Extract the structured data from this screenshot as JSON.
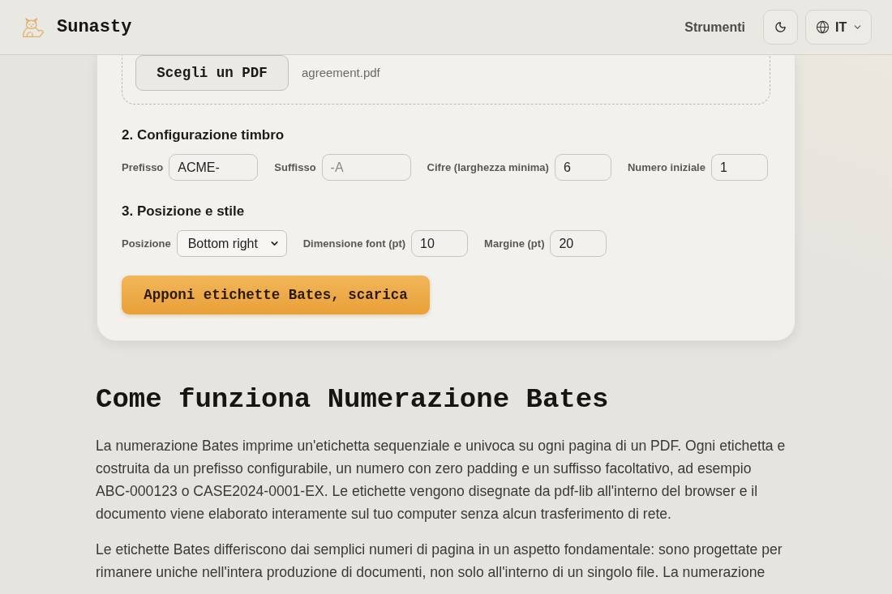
{
  "header": {
    "brand": "Sunasty",
    "nav_link": "Strumenti",
    "language": "IT"
  },
  "upload": {
    "button": "Scegli un PDF",
    "file_name": "agreement.pdf"
  },
  "sections": [
    {
      "title": "2. Configurazione timbro",
      "fields": [
        {
          "label": "Prefisso",
          "kind": "text",
          "value": "ACME-"
        },
        {
          "label": "Suffisso",
          "kind": "text",
          "placeholder": "-A"
        },
        {
          "label": "Cifre (larghezza minima)",
          "kind": "number",
          "value": "6"
        },
        {
          "label": "Numero iniziale",
          "kind": "number",
          "value": "1"
        }
      ]
    },
    {
      "title": "3. Posizione e stile",
      "fields": [
        {
          "label": "Posizione",
          "kind": "select",
          "value": "Bottom right"
        },
        {
          "label": "Dimensione font (pt)",
          "kind": "number",
          "value": "10"
        },
        {
          "label": "Margine (pt)",
          "kind": "number",
          "value": "20"
        }
      ]
    }
  ],
  "submit_button": "Apponi etichette Bates, scarica",
  "article": {
    "heading": "Come funziona Numerazione Bates",
    "paragraphs": [
      "La numerazione Bates imprime un'etichetta sequenziale e univoca su ogni pagina di un PDF. Ogni etichetta e costruita da un prefisso configurabile, un numero con zero padding e un suffisso facoltativo, ad esempio ABC-000123 o CASE2024-0001-EX. Le etichette vengono disegnate da pdf-lib all'interno del browser e il documento viene elaborato interamente sul tuo computer senza alcun trasferimento di rete.",
      "Le etichette Bates differiscono dai semplici numeri di pagina in un aspetto fondamentale: sono progettate per rimanere uniche nell'intera produzione di documenti, non solo all'interno di un singolo file. La numerazione"
    ]
  }
}
